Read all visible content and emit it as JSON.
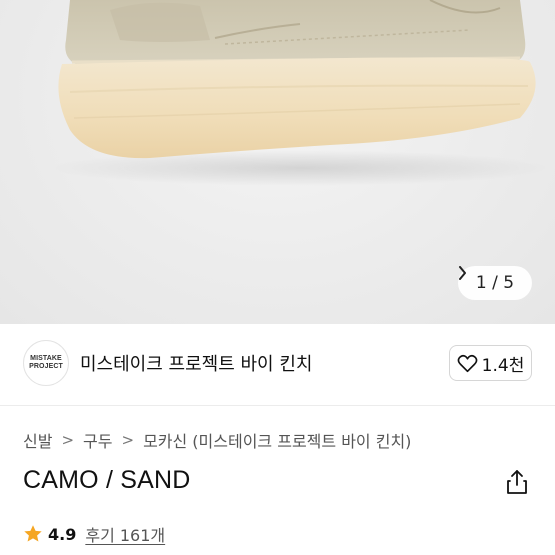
{
  "gallery": {
    "current": "1",
    "separator": "/",
    "total": "5"
  },
  "store": {
    "logo_text_line1": "MISTAKE",
    "logo_text_line2": "PROJECT",
    "name": "미스테이크 프로젝트 바이 킨치"
  },
  "like": {
    "count": "1.4천"
  },
  "breadcrumb": {
    "items": [
      "신발",
      "구두",
      "모카신 (미스테이크 프로젝트 바이 킨치)"
    ],
    "separator": ">"
  },
  "product": {
    "title": "CAMO / SAND"
  },
  "rating": {
    "score": "4.9",
    "reviews": "후기 161개"
  },
  "colors": {
    "star": "#f5a623",
    "shoe_upper": "#cfc8b3",
    "shoe_sole": "#f2e3c6"
  }
}
